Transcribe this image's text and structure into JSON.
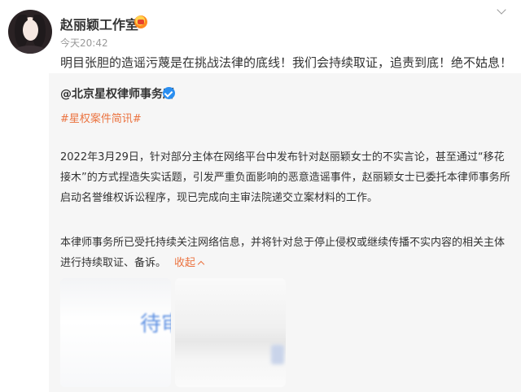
{
  "post": {
    "author": "赵丽颖工作室",
    "time": "今天20:42",
    "text": "明目张胆的造谣污蔑是在挑战法律的底线！我们会持续取证，追责到底！绝不姑息！"
  },
  "repost": {
    "author": "@北京星权律师事务所",
    "hashtag": "#星权案件简讯#",
    "paragraph1": "2022年3月29日，针对部分主体在网络平台中发布针对赵丽颖女士的不实言论，甚至通过“移花接木”的方式捏造失实话题，引发严重负面影响的恶意造谣事件，赵丽颖女士已委托本律师事务所启动名誉维权诉讼程序，现已完成向主审法院递交立案材料的工作。",
    "paragraph2": "本律师事务所已受托持续关注网络信息，并将针对怠于停止侵权或继续传播不实内容的相关主体进行持续取证、备诉。",
    "collapse_label": "收起",
    "thumb1_text": "待审"
  },
  "colors": {
    "accent": "#eb7340",
    "verified": "#2a8ef0",
    "muted": "#999999",
    "repost_bg": "#f6f6f6"
  },
  "icons": [
    "vip-badge-icon",
    "chevron-down-icon",
    "verified-icon",
    "chevron-up-icon"
  ]
}
